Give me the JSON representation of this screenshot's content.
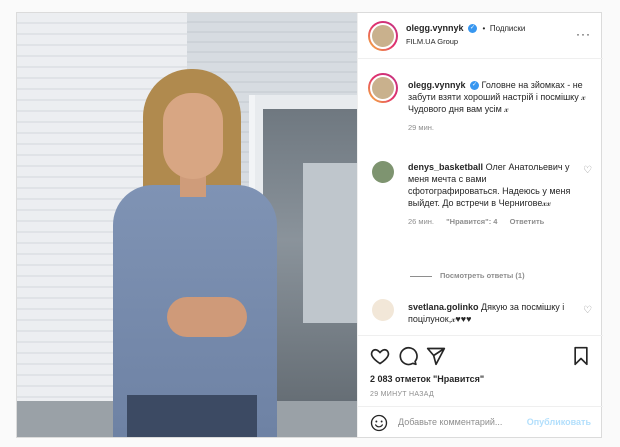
{
  "header": {
    "username": "olegg.vynnyk",
    "separator": "•",
    "follow_label": "Подписки",
    "subtitle": "FILM.UA Group",
    "more_label": "···"
  },
  "caption": {
    "username": "olegg.vynnyk",
    "text": "Головне на зйомках - не забути взяти хороший настрій і посмішку 𝓍 Чудового дня вам усім 𝓍",
    "time": "29 мин."
  },
  "comments": [
    {
      "username": "denys_basketball",
      "text": "Олег Анатольевич у меня мечта с вами сфотографироваться. Надеюсь у меня выйдет. До встречи в Чернигове𝓍𝓍",
      "time": "26 мин.",
      "likes": "\"Нравится\": 4",
      "reply_label": "Ответить"
    },
    {
      "username": "svetlana.golinko",
      "text": "Дякую за посмішку і поцілунок,𝓍♥♥♥"
    }
  ],
  "view_replies": "Посмотреть ответы (1)",
  "likes_count": "2 083 отметок \"Нравится\"",
  "posted_time": "29 МИНУТ НАЗАД",
  "add_comment": {
    "placeholder": "Добавьте комментарий...",
    "publish_label": "Опубликовать"
  },
  "colors": {
    "verified": "#3897f0",
    "publish_disabled": "#b2dffc",
    "muted": "#8e8e8e"
  }
}
